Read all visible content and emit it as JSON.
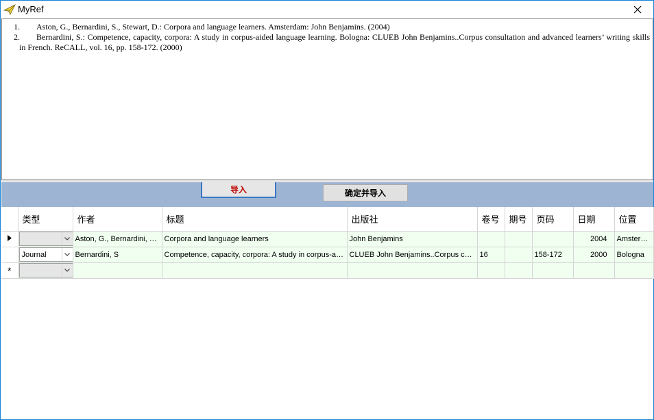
{
  "window": {
    "title": "MyRef",
    "close_icon": "close-icon",
    "app_icon": "paper-plane-icon"
  },
  "references": [
    {
      "num": "1.",
      "text": "Aston, G., Bernardini, S., Stewart, D.: Corpora and language learners. Amsterdam: John Benjamins. (2004)"
    },
    {
      "num": "2.",
      "text": "Bernardini, S.: Competence, capacity, corpora: A study in corpus-aided language learning. Bologna: CLUEB John Benjamins..Corpus consultation and advanced learners’ writing skills in French. ReCALL, vol. 16, pp. 158-172. (2000)"
    }
  ],
  "toolbar": {
    "import_label": "导入",
    "confirm_import_label": "确定并导入"
  },
  "grid": {
    "columns": [
      "类型",
      "作者",
      "标题",
      "出版社",
      "卷号",
      "期号",
      "页码",
      "日期",
      "位置"
    ],
    "rows": [
      {
        "current": true,
        "type": "",
        "author": "Aston, G., Bernardini, S., Stewart, D.",
        "title": "Corpora and language learners",
        "publisher": "John Benjamins",
        "volume": "",
        "issue": "",
        "pages": "",
        "date": "2004",
        "location": "Amsterdam"
      },
      {
        "current": false,
        "type": "Journal",
        "author": "Bernardini, S",
        "title": "Competence, capacity, corpora: A study in corpus-aided language learning",
        "publisher": "CLUEB John Benjamins..Corpus consultation and advanced learners’ writing skills in French",
        "volume": "16",
        "issue": "",
        "pages": "158-172",
        "date": "2000",
        "location": "Bologna"
      }
    ],
    "new_row_marker": "*"
  },
  "colors": {
    "toolbar_band": "#9db5d3",
    "row_background": "#f0fff0",
    "import_text": "#c00000",
    "window_border": "#1883d7"
  }
}
